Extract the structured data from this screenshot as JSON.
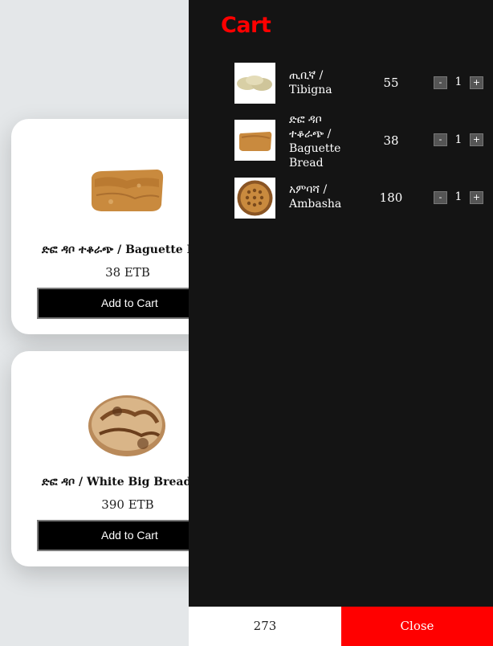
{
  "products": [
    {
      "name": "ድፎ ዳቦ ተቆራጭ / Baguette Bread",
      "price": "38 ETB",
      "button": "Add to Cart",
      "image_icon": "baguette-bread-image"
    },
    {
      "name": "ድፎ ዳቦ / White Big Bread",
      "price": "390 ETB",
      "button": "Add to Cart",
      "image_icon": "white-big-bread-image"
    }
  ],
  "cart": {
    "title": "Cart",
    "title_color": "#ff0000",
    "items": [
      {
        "name": "ጢቢኛ / Tibigna",
        "price": "55",
        "qty": "1",
        "minus": "-",
        "plus": "+",
        "image_icon": "tibigna-image"
      },
      {
        "name": "ድፎ ዳቦ ተቆራጭ / Baguette Bread",
        "price": "38",
        "qty": "1",
        "minus": "-",
        "plus": "+",
        "image_icon": "baguette-bread-image"
      },
      {
        "name": "አምባሻ / Ambasha",
        "price": "180",
        "qty": "1",
        "minus": "-",
        "plus": "+",
        "image_icon": "ambasha-image"
      }
    ],
    "total": "273",
    "close_label": "Close",
    "close_color": "#ff0000"
  }
}
